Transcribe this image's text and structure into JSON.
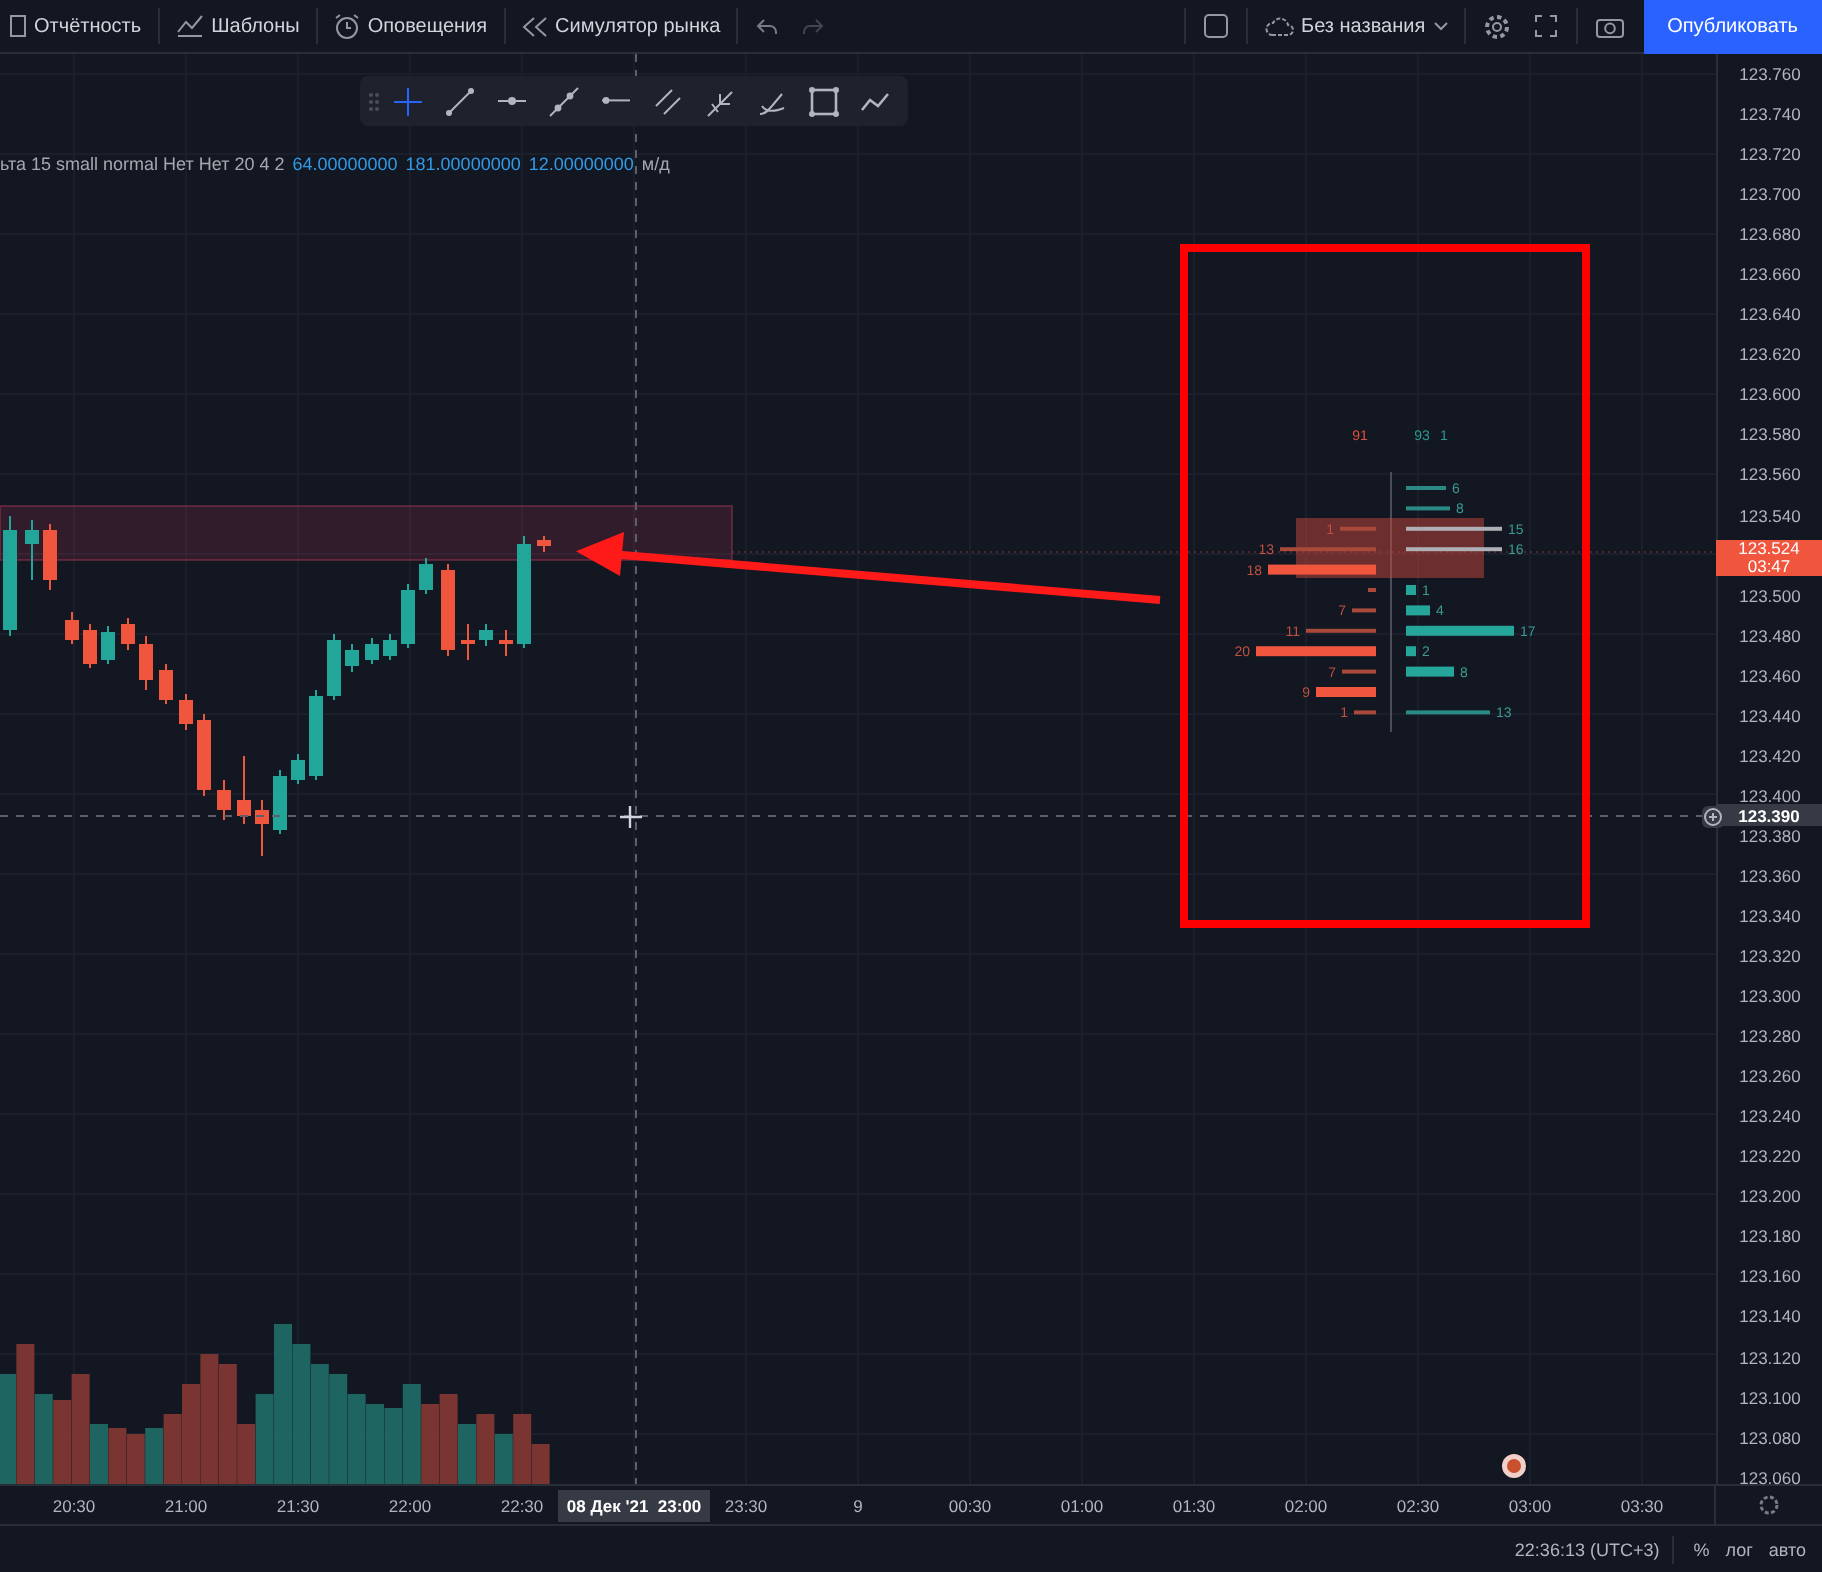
{
  "top_toolbar": {
    "items": [
      "Отчётность",
      "Шаблоны",
      "Оповещения",
      "Симулятор рынка"
    ],
    "layout_name": "Без названия",
    "publish_button": "Опубликовать"
  },
  "drawing_toolbar": {
    "tools": [
      {
        "selected": true
      },
      {
        "selected": false
      },
      {
        "selected": false
      },
      {
        "selected": false
      },
      {
        "selected": false
      },
      {
        "selected": false
      },
      {
        "selected": false
      },
      {
        "selected": false
      },
      {
        "selected": false
      },
      {
        "selected": false
      }
    ]
  },
  "legend": {
    "text": "ьта 15 small normal Нет Нет 20 4 2",
    "values": [
      "64.00000000",
      "181.00000000",
      "12.00000000"
    ],
    "unit": "м/д"
  },
  "footprint": {
    "header": [
      {
        "text": "91",
        "kind": "sell"
      },
      {
        "text": "93",
        "kind": "buy"
      },
      {
        "text": "1",
        "kind": "buy"
      }
    ],
    "rows": [
      {
        "ask": "6"
      },
      {
        "ask": "8"
      },
      {
        "bid": "1",
        "ask": "15"
      },
      {
        "bid": "13",
        "ask": "16"
      },
      {
        "bid": "18"
      },
      {
        "ask": "1"
      },
      {
        "bid": "7",
        "ask": "4"
      },
      {
        "bid": "11",
        "ask": "17"
      },
      {
        "bid": "20",
        "ask": "2"
      },
      {
        "bid": "7",
        "ask": "8"
      },
      {
        "bid": "9"
      },
      {
        "bid": "1",
        "ask": "13"
      }
    ]
  },
  "price_axis": {
    "upper_labels": [
      "123.760",
      "123.740",
      "123.720",
      "123.700",
      "123.680",
      "123.660",
      "123.640",
      "123.620",
      "123.600",
      "123.580",
      "123.560",
      "123.540"
    ],
    "lower_labels": [
      "123.500",
      "123.480",
      "123.460",
      "123.440",
      "123.420",
      "123.400",
      "123.380",
      "123.360",
      "123.340",
      "123.320",
      "123.300",
      "123.280",
      "123.260",
      "123.240",
      "123.220",
      "123.200",
      "123.180",
      "123.160",
      "123.140",
      "123.120",
      "123.100",
      "123.080",
      "123.060"
    ],
    "last_price": {
      "price": "123.524",
      "countdown": "03:47"
    },
    "crosshair_price": "123.390"
  },
  "time_axis": {
    "labels": [
      {
        "kind": "tick",
        "text": "20:30"
      },
      {
        "kind": "tick",
        "text": "21:00"
      },
      {
        "kind": "tick",
        "text": "21:30"
      },
      {
        "kind": "tick",
        "text": "22:00"
      },
      {
        "kind": "tick",
        "text": "22:30"
      },
      {
        "kind": "crosshair",
        "text": "08 Дек '21  23:00"
      },
      {
        "kind": "tick",
        "text": "23:30"
      },
      {
        "kind": "tick",
        "text": "9"
      },
      {
        "kind": "tick",
        "text": "00:30"
      },
      {
        "kind": "tick",
        "text": "01:00"
      },
      {
        "kind": "tick",
        "text": "01:30"
      },
      {
        "kind": "tick",
        "text": "02:00"
      },
      {
        "kind": "tick",
        "text": "02:30"
      },
      {
        "kind": "tick",
        "text": "03:00"
      },
      {
        "kind": "tick",
        "text": "03:30"
      }
    ]
  },
  "status_bar": {
    "time": "22:36:13 (UTC+3)",
    "buttons": [
      "%",
      "лог",
      "авто"
    ]
  }
}
